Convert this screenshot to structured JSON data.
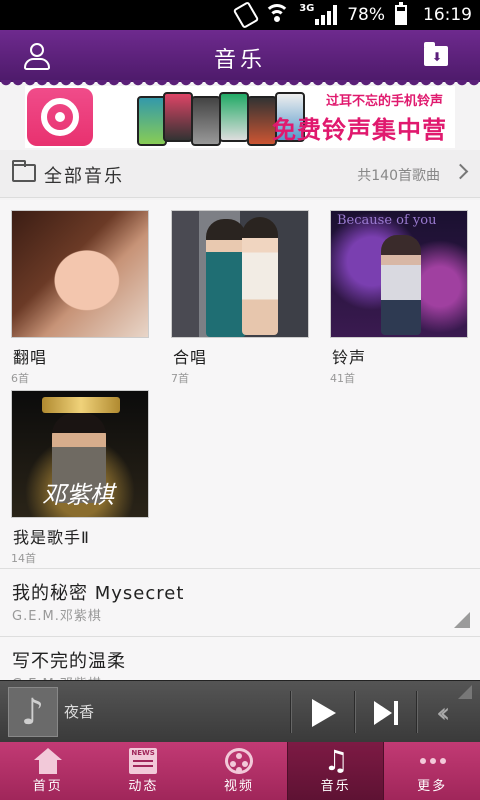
{
  "status_bar": {
    "network": "3G",
    "battery": "78%",
    "time": "16:19"
  },
  "header": {
    "title": "音乐"
  },
  "banner": {
    "line1": "过耳不忘的手机铃声",
    "line2": "免费铃声集中营"
  },
  "all_music": {
    "label": "全部音乐",
    "count": "共140首歌曲"
  },
  "categories": [
    {
      "name": "翻唱",
      "count": "6首"
    },
    {
      "name": "合唱",
      "count": "7首"
    },
    {
      "name": "铃声",
      "count": "41首"
    },
    {
      "name": "我是歌手Ⅱ",
      "count": "14首"
    }
  ],
  "thumb_text": {
    "because_of_you": "Because of you",
    "calligraphy": "邓紫棋"
  },
  "songs": [
    {
      "title": "我的秘密 Mysecret",
      "artist": "G.E.M.邓紫棋"
    },
    {
      "title": "写不完的温柔",
      "artist": "G.E.M.邓紫棋"
    }
  ],
  "player": {
    "now_playing": "夜香"
  },
  "tabs": [
    {
      "label": "首页",
      "icon": "home-icon"
    },
    {
      "label": "动态",
      "icon": "news-icon"
    },
    {
      "label": "视频",
      "icon": "video-icon"
    },
    {
      "label": "音乐",
      "icon": "music-icon"
    },
    {
      "label": "更多",
      "icon": "more-icon"
    }
  ],
  "colors": {
    "header": "#5a1f78",
    "tabbar": "#b02f66",
    "accent": "#e0196e"
  }
}
